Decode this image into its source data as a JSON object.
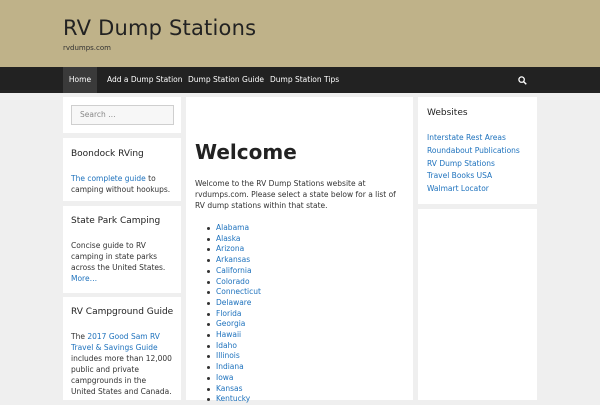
{
  "site": {
    "title": "RV Dump Stations",
    "tagline": "rvdumps.com"
  },
  "nav": {
    "items": [
      {
        "label": "Home"
      },
      {
        "label": "Add a Dump Station"
      },
      {
        "label": "Dump Station Guide"
      },
      {
        "label": "Dump Station Tips"
      }
    ]
  },
  "search": {
    "placeholder": "Search …"
  },
  "widgets": {
    "boondock": {
      "title": "Boondock RVing",
      "link": "The complete guide",
      "text": "to camping without hookups."
    },
    "state_park": {
      "title": "State Park Camping",
      "text": "Concise guide to RV camping in state parks across the United States.",
      "more": "More…"
    },
    "campground": {
      "title": "RV Campground Guide",
      "text_pre": "The ",
      "link": "2017 Good Sam RV Travel & Savings Guide",
      "text_post": " includes more than 12,000 public and private campgrounds in the United States and Canada."
    },
    "websites": {
      "title": "Websites",
      "links": [
        "Interstate Rest Areas",
        "Roundabout Publications",
        "RV Dump Stations",
        "Travel Books USA",
        "Walmart Locator"
      ]
    }
  },
  "main": {
    "heading": "Welcome",
    "intro": "Welcome to the RV Dump Stations website at rvdumps.com. Please select a state below for a list of RV dump stations within that state.",
    "states": [
      "Alabama",
      "Alaska",
      "Arizona",
      "Arkansas",
      "California",
      "Colorado",
      "Connecticut",
      "Delaware",
      "Florida",
      "Georgia",
      "Hawaii",
      "Idaho",
      "Illinois",
      "Indiana",
      "Iowa",
      "Kansas",
      "Kentucky"
    ]
  }
}
